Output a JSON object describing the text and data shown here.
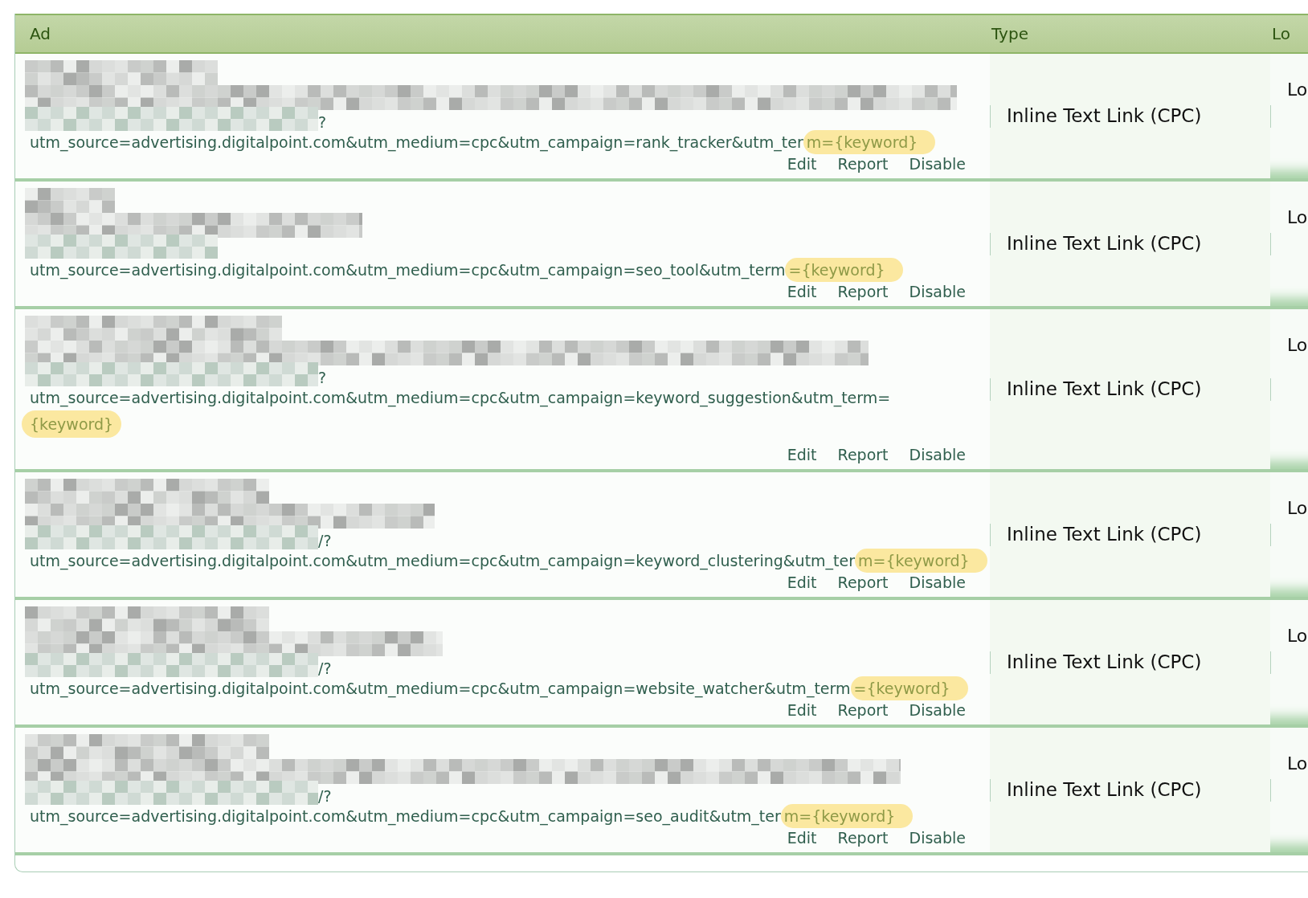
{
  "table": {
    "columns": [
      "Ad",
      "Type",
      "Lo"
    ],
    "rows": [
      {
        "url_tail": "?",
        "utm": {
          "before": "utm_source=advertising.digitalpoint.com&utm_medium=cpc&utm_campaign=rank_tracker&utm_ter",
          "highlight": "m={keyword}",
          "wrap": false
        },
        "actions": [
          "Edit",
          "Report",
          "Disable"
        ],
        "type": "Inline Text Link (CPC)",
        "col3": "Lo"
      },
      {
        "url_tail": "",
        "utm": {
          "before": "utm_source=advertising.digitalpoint.com&utm_medium=cpc&utm_campaign=seo_tool&utm_term",
          "highlight": "={keyword}",
          "wrap": false
        },
        "actions": [
          "Edit",
          "Report",
          "Disable"
        ],
        "type": "Inline Text Link (CPC)",
        "col3": "Lo"
      },
      {
        "url_tail": "?",
        "utm": {
          "before": "utm_source=advertising.digitalpoint.com&utm_medium=cpc&utm_campaign=keyword_suggestion&utm_term=",
          "highlight": "{keyword}",
          "wrap": true
        },
        "actions": [
          "Edit",
          "Report",
          "Disable"
        ],
        "type": "Inline Text Link (CPC)",
        "col3": "Lo"
      },
      {
        "url_tail": "/?",
        "utm": {
          "before": "utm_source=advertising.digitalpoint.com&utm_medium=cpc&utm_campaign=keyword_clustering&utm_ter",
          "highlight": "m={keyword}",
          "wrap": false
        },
        "actions": [
          "Edit",
          "Report",
          "Disable"
        ],
        "type": "Inline Text Link (CPC)",
        "col3": "Lo"
      },
      {
        "url_tail": "/?",
        "utm": {
          "before": "utm_source=advertising.digitalpoint.com&utm_medium=cpc&utm_campaign=website_watcher&utm_term",
          "highlight": "={keyword}",
          "wrap": false
        },
        "actions": [
          "Edit",
          "Report",
          "Disable"
        ],
        "type": "Inline Text Link (CPC)",
        "col3": "Lo"
      },
      {
        "url_tail": "/?",
        "utm": {
          "before": "utm_source=advertising.digitalpoint.com&utm_medium=cpc&utm_campaign=seo_audit&utm_ter",
          "highlight": "m={keyword}",
          "wrap": false
        },
        "actions": [
          "Edit",
          "Report",
          "Disable"
        ],
        "type": "Inline Text Link (CPC)",
        "col3": "Lo"
      }
    ]
  }
}
